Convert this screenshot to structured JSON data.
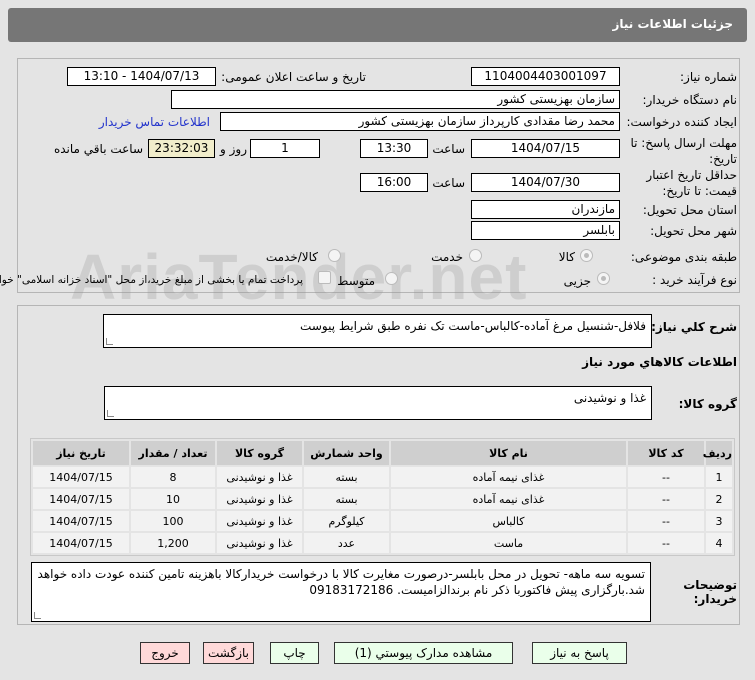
{
  "header": {
    "title": "جزئیات اطلاعات نیاز"
  },
  "watermark": "AriaTender.net",
  "form": {
    "need_number_label": "شماره نیاز:",
    "need_number": "1104004403001097",
    "announce_label": "تاریخ و ساعت اعلان عمومی:",
    "announce_value": "1404/07/13 - 13:10",
    "buyer_org_label": "نام دستگاه خریدار:",
    "buyer_org": "سازمان بهزیستی کشور",
    "creator_label": "ایجاد کننده درخواست:",
    "creator": "محمد رضا  مقدادی کارپرداز سازمان بهزیستی کشور",
    "contact_link": "اطلاعات تماس خریدار",
    "deadline_label_1": "مهلت ارسال پاسخ: تا",
    "deadline_label_2": "تاریخ:",
    "deadline_date": "1404/07/15",
    "time_label": "ساعت",
    "deadline_time": "13:30",
    "days": "1",
    "days_label": "روز و",
    "remaining": "23:32:03",
    "remaining_label": "ساعت باقي مانده",
    "validity_label_1": "حداقل تاریخ اعتبار",
    "validity_label_2": "قیمت: تا تاریخ:",
    "validity_date": "1404/07/30",
    "validity_time": "16:00",
    "province_label": "استان محل تحویل:",
    "province": "مازندران",
    "city_label": "شهر محل تحویل:",
    "city": "بابلسر",
    "category_label": "طبقه بندی موضوعی:",
    "category_options": [
      "کالا",
      "خدمت",
      "کالا/خدمت"
    ],
    "process_label": "نوع فرآیند خرید :",
    "process_options": [
      "جزیی",
      "متوسط"
    ],
    "payment_note": "پرداخت تمام یا بخشی از مبلغ خرید،از محل \"اسناد خزانه اسلامی\" خواهد بود."
  },
  "details": {
    "description_label": "شرح کلي نیاز:",
    "description": "فلافل-شنسیل مرغ آماده-کالباس-ماست تک نفره  طبق شرایط پیوست",
    "goods_heading": "اطلاعات کالاهاي مورد نیاز",
    "group_label": "گروه کالا:",
    "group": "غذا و نوشیدنی",
    "table": {
      "headers": [
        "ردیف",
        "کد کالا",
        "نام کالا",
        "واحد شمارش",
        "گروه کالا",
        "تعداد / مقدار",
        "تاریخ نیاز"
      ],
      "rows": [
        [
          "1",
          "--",
          "غذای نیمه آماده",
          "بسته",
          "غذا و نوشیدنی",
          "8",
          "1404/07/15"
        ],
        [
          "2",
          "--",
          "غذای نیمه آماده",
          "بسته",
          "غذا و نوشیدنی",
          "10",
          "1404/07/15"
        ],
        [
          "3",
          "--",
          "کالباس",
          "کیلوگرم",
          "غذا و نوشیدنی",
          "100",
          "1404/07/15"
        ],
        [
          "4",
          "--",
          "ماست",
          "عدد",
          "غذا و نوشیدنی",
          "1,200",
          "1404/07/15"
        ]
      ]
    },
    "buyer_notes_label": "توضیحات خریدار:",
    "buyer_notes": "تسویه سه ماهه- تحویل در محل بابلسر-درصورت مغایرت کالا با درخواست خریدارکالا باهزینه تامین کننده عودت داده خواهد شد.بارگزاری پیش فاکتوربا ذکر نام برندالزامیست. 09183172186"
  },
  "buttons": {
    "reply": "پاسخ به نیاز",
    "attachments": "مشاهده مدارک پیوستي (1)",
    "print": "چاپ",
    "back": "بازگشت",
    "exit": "خروج"
  }
}
